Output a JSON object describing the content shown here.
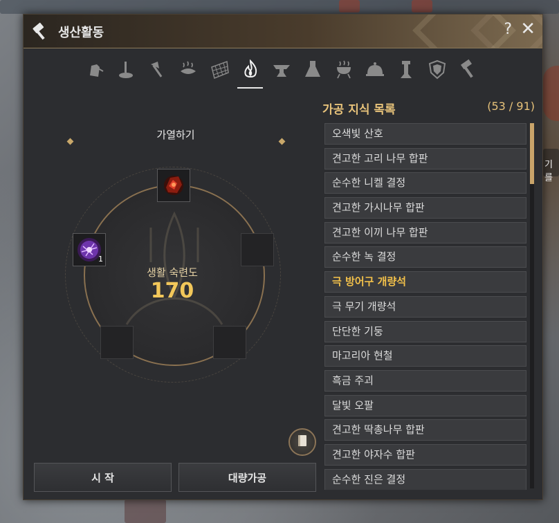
{
  "window": {
    "title": "생산활동",
    "help_label": "?",
    "close_label": "✕"
  },
  "tabs": [
    {
      "icon": "gathering-icon",
      "active": false
    },
    {
      "icon": "alchemy-stir-icon",
      "active": false
    },
    {
      "icon": "axe-icon",
      "active": false
    },
    {
      "icon": "fishing-icon",
      "active": false
    },
    {
      "icon": "net-icon",
      "active": false
    },
    {
      "icon": "fire-icon",
      "active": true
    },
    {
      "icon": "anvil-icon",
      "active": false
    },
    {
      "icon": "flask-icon",
      "active": false
    },
    {
      "icon": "grill-icon",
      "active": false
    },
    {
      "icon": "cloche-icon",
      "active": false
    },
    {
      "icon": "tower-icon",
      "active": false
    },
    {
      "icon": "shield-icon",
      "active": false
    },
    {
      "icon": "hammer-icon",
      "active": false
    }
  ],
  "process": {
    "name": "가열하기",
    "mastery_label": "생활 숙련도",
    "mastery_value": "170",
    "slots": [
      {
        "item": "fire-ore-icon",
        "qty": ""
      },
      {
        "item": "purple-orb-icon",
        "qty": "1"
      },
      {
        "item": "",
        "qty": ""
      },
      {
        "item": "",
        "qty": ""
      },
      {
        "item": "",
        "qty": ""
      }
    ]
  },
  "buttons": {
    "start": "시 작",
    "bulk": "대량가공"
  },
  "recipe_list": {
    "title": "가공 지식 목록",
    "count": "(53 / 91)",
    "items": [
      {
        "label": "오색빛 산호",
        "highlight": false
      },
      {
        "label": "견고한 고리 나무 합판",
        "highlight": false
      },
      {
        "label": "순수한 니켈 결정",
        "highlight": false
      },
      {
        "label": "견고한 가시나무 합판",
        "highlight": false
      },
      {
        "label": "견고한 이끼 나무 합판",
        "highlight": false
      },
      {
        "label": "순수한 녹 결정",
        "highlight": false
      },
      {
        "label": "극 방어구 개량석",
        "highlight": true
      },
      {
        "label": "극 무기 개량석",
        "highlight": false
      },
      {
        "label": "단단한 기둥",
        "highlight": false
      },
      {
        "label": "마고리아 현철",
        "highlight": false
      },
      {
        "label": "흑금 주괴",
        "highlight": false
      },
      {
        "label": "달빛 오팔",
        "highlight": false
      },
      {
        "label": "견고한 딱총나무 합판",
        "highlight": false
      },
      {
        "label": "견고한 야자수 합판",
        "highlight": false
      },
      {
        "label": "순수한 진은 결정",
        "highlight": false
      }
    ],
    "scroll_fraction": 0.0
  },
  "background_text": {
    "side_label": "기를"
  }
}
